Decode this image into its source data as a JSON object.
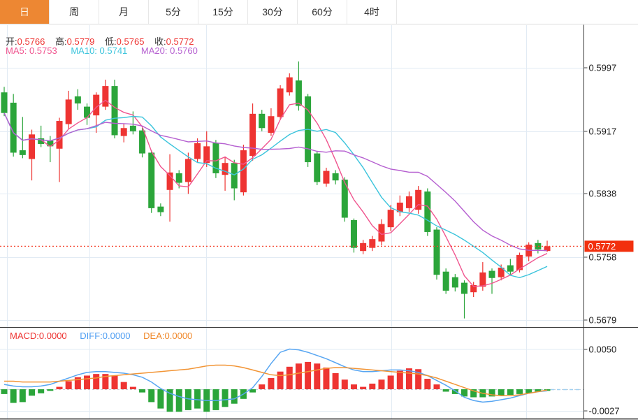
{
  "tabs": [
    {
      "id": "tab-day",
      "label": "日",
      "active": true
    },
    {
      "id": "tab-week",
      "label": "周",
      "active": false
    },
    {
      "id": "tab-month",
      "label": "月",
      "active": false
    },
    {
      "id": "tab-5min",
      "label": "5分",
      "active": false
    },
    {
      "id": "tab-15min",
      "label": "15分",
      "active": false
    },
    {
      "id": "tab-30min",
      "label": "30分",
      "active": false
    },
    {
      "id": "tab-60min",
      "label": "60分",
      "active": false
    },
    {
      "id": "tab-4hour",
      "label": "4时",
      "active": false
    }
  ],
  "legend": {
    "open_label": "开:",
    "open_value": "0.5766",
    "high_label": "高:",
    "high_value": "0.5779",
    "low_label": "低:",
    "low_value": "0.5765",
    "close_label": "收:",
    "close_value": "0.5772",
    "ma5": "MA5: 0.5753",
    "ma10": "MA10: 0.5741",
    "ma20": "MA20: 0.5760",
    "macd": "MACD:0.0000",
    "diff": "DIFF:0.0000",
    "dea": "DEA:0.0000"
  },
  "colors": {
    "tab_active": "#ed8733",
    "up": "#ee3432",
    "down": "#2ba53a",
    "ma5": "#f0558f",
    "ma10": "#3bc4dc",
    "ma20": "#b55fd0",
    "diff_line": "#58a6f2",
    "dea_line": "#f29536",
    "badge": "#f2300e",
    "price_line": "#f5442e",
    "grid": "#e2ebf4",
    "axis": "#3a3a3a",
    "tick_text": "#1a1a1a",
    "zero_dash": "#c4cfd9",
    "future_dash": "#9fd0f2"
  },
  "chart_data": {
    "type": "candlestick",
    "title": "",
    "legend_position": "top-left",
    "grid": true,
    "price_axis": {
      "labels": [
        "0.5997",
        "0.5917",
        "0.5838",
        "0.5758",
        "0.5679"
      ],
      "values": [
        0.5997,
        0.5917,
        0.5838,
        0.5758,
        0.5679
      ]
    },
    "last_price": {
      "label": "0.5772",
      "value": 0.5772
    },
    "current_candle": {
      "open": 0.5766,
      "high": 0.5779,
      "low": 0.5765,
      "close": 0.5772
    },
    "ma_periods": [
      5,
      10,
      20
    ],
    "ma_current": {
      "ma5": 0.5753,
      "ma10": 0.5741,
      "ma20": 0.576
    },
    "x_gridlines": [
      10,
      128,
      295,
      560,
      753
    ],
    "candles_ohlc": [
      [
        0.5966,
        0.5973,
        0.5936,
        0.594
      ],
      [
        0.5953,
        0.5964,
        0.5885,
        0.589
      ],
      [
        0.5893,
        0.5935,
        0.5883,
        0.5887
      ],
      [
        0.5882,
        0.5919,
        0.5855,
        0.5913
      ],
      [
        0.5908,
        0.5924,
        0.5897,
        0.5901
      ],
      [
        0.5905,
        0.5911,
        0.5878,
        0.5898
      ],
      [
        0.5895,
        0.5934,
        0.5853,
        0.593
      ],
      [
        0.5926,
        0.5968,
        0.592,
        0.5957
      ],
      [
        0.5961,
        0.597,
        0.5944,
        0.5952
      ],
      [
        0.5948,
        0.5952,
        0.5925,
        0.5934
      ],
      [
        0.5937,
        0.5966,
        0.5915,
        0.5963
      ],
      [
        0.5948,
        0.5982,
        0.5944,
        0.5974
      ],
      [
        0.5974,
        0.5982,
        0.5908,
        0.5912
      ],
      [
        0.5911,
        0.5926,
        0.5903,
        0.5921
      ],
      [
        0.5924,
        0.5942,
        0.5913,
        0.5917
      ],
      [
        0.5918,
        0.5921,
        0.5884,
        0.5889
      ],
      [
        0.589,
        0.5893,
        0.5814,
        0.582
      ],
      [
        0.5822,
        0.5826,
        0.581,
        0.5815
      ],
      [
        0.5843,
        0.5888,
        0.5803,
        0.5865
      ],
      [
        0.5864,
        0.5868,
        0.5845,
        0.5852
      ],
      [
        0.5853,
        0.589,
        0.5838,
        0.5882
      ],
      [
        0.5882,
        0.5908,
        0.5878,
        0.5902
      ],
      [
        0.5877,
        0.5917,
        0.5872,
        0.5898
      ],
      [
        0.5902,
        0.5906,
        0.5858,
        0.5864
      ],
      [
        0.5862,
        0.5884,
        0.5842,
        0.5877
      ],
      [
        0.5877,
        0.5881,
        0.583,
        0.5845
      ],
      [
        0.584,
        0.59,
        0.5836,
        0.5893
      ],
      [
        0.5886,
        0.5952,
        0.588,
        0.5939
      ],
      [
        0.5939,
        0.5944,
        0.5917,
        0.5921
      ],
      [
        0.5915,
        0.5946,
        0.5911,
        0.5936
      ],
      [
        0.5935,
        0.5975,
        0.5931,
        0.5971
      ],
      [
        0.5966,
        0.599,
        0.5962,
        0.5985
      ],
      [
        0.5981,
        0.6005,
        0.5943,
        0.5949
      ],
      [
        0.5961,
        0.5964,
        0.5872,
        0.5878
      ],
      [
        0.5889,
        0.5892,
        0.5849,
        0.5853
      ],
      [
        0.5851,
        0.5871,
        0.5847,
        0.5867
      ],
      [
        0.5864,
        0.5868,
        0.585,
        0.5855
      ],
      [
        0.5856,
        0.5859,
        0.5803,
        0.5808
      ],
      [
        0.5805,
        0.5807,
        0.5764,
        0.577
      ],
      [
        0.5766,
        0.578,
        0.5762,
        0.5776
      ],
      [
        0.577,
        0.5785,
        0.5766,
        0.5781
      ],
      [
        0.5778,
        0.5806,
        0.5773,
        0.58
      ],
      [
        0.5796,
        0.5824,
        0.5791,
        0.5818
      ],
      [
        0.5815,
        0.5836,
        0.581,
        0.5827
      ],
      [
        0.582,
        0.5841,
        0.5815,
        0.5835
      ],
      [
        0.5818,
        0.5848,
        0.5813,
        0.5843
      ],
      [
        0.5841,
        0.5845,
        0.5785,
        0.579
      ],
      [
        0.5793,
        0.5796,
        0.573,
        0.5736
      ],
      [
        0.574,
        0.5744,
        0.5712,
        0.5716
      ],
      [
        0.5733,
        0.5737,
        0.5715,
        0.572
      ],
      [
        0.5726,
        0.5729,
        0.5681,
        0.5712
      ],
      [
        0.5714,
        0.5727,
        0.5708,
        0.5723
      ],
      [
        0.5721,
        0.5752,
        0.5716,
        0.5739
      ],
      [
        0.5741,
        0.5744,
        0.5712,
        0.5732
      ],
      [
        0.5733,
        0.5749,
        0.5729,
        0.5745
      ],
      [
        0.5748,
        0.5756,
        0.5736,
        0.574
      ],
      [
        0.5742,
        0.5764,
        0.5739,
        0.5761
      ],
      [
        0.5759,
        0.5777,
        0.5753,
        0.5774
      ],
      [
        0.5776,
        0.578,
        0.5763,
        0.5768
      ],
      [
        0.5766,
        0.5779,
        0.5765,
        0.5772
      ]
    ],
    "macd_axis": {
      "labels": [
        "0.0050",
        "-0.0027"
      ],
      "values": [
        0.005,
        -0.0027
      ]
    },
    "macd": {
      "unit": 0.0001,
      "current": {
        "macd": 0.0,
        "diff": 0.0,
        "dea": 0.0
      },
      "histogram": [
        -6,
        -17,
        -16,
        -8,
        -5,
        -2,
        3,
        10,
        15,
        17,
        19,
        19,
        17,
        9,
        3,
        -4,
        -16,
        -24,
        -28,
        -28,
        -26,
        -24,
        -28,
        -26,
        -22,
        -18,
        -12,
        -4,
        6,
        14,
        22,
        28,
        32,
        34,
        32,
        27,
        20,
        12,
        6,
        3,
        7,
        12,
        17,
        23,
        26,
        25,
        13,
        6,
        -3,
        -6,
        -9,
        -10,
        -10,
        -9,
        -8,
        -7,
        -6,
        -5,
        -3,
        -2
      ],
      "diff": [
        6,
        4,
        3,
        3,
        4,
        6,
        10,
        14,
        18,
        21,
        22,
        22,
        21,
        20,
        18,
        15,
        9,
        1,
        -5,
        -9,
        -12,
        -13,
        -14,
        -14,
        -13,
        -12,
        -6,
        2,
        16,
        32,
        46,
        50,
        49,
        46,
        42,
        38,
        33,
        28,
        24,
        22,
        22,
        23,
        24,
        24,
        23,
        21,
        17,
        11,
        5,
        -2,
        -10,
        -14,
        -16,
        -15,
        -13,
        -11,
        -8,
        -5,
        -3,
        -2
      ],
      "dea": [
        10,
        10,
        9,
        9,
        9,
        9,
        10,
        11,
        12,
        13,
        14,
        16,
        17,
        18,
        19,
        20,
        21,
        22,
        23,
        24,
        25,
        27,
        29,
        30,
        30,
        29,
        27,
        24,
        21,
        18,
        17,
        18,
        20,
        22,
        24,
        26,
        27,
        27,
        26,
        25,
        24,
        23,
        22,
        21,
        20,
        19,
        17,
        14,
        10,
        6,
        2,
        -2,
        -5,
        -7,
        -8,
        -8,
        -7,
        -5,
        -3,
        -1
      ]
    }
  }
}
